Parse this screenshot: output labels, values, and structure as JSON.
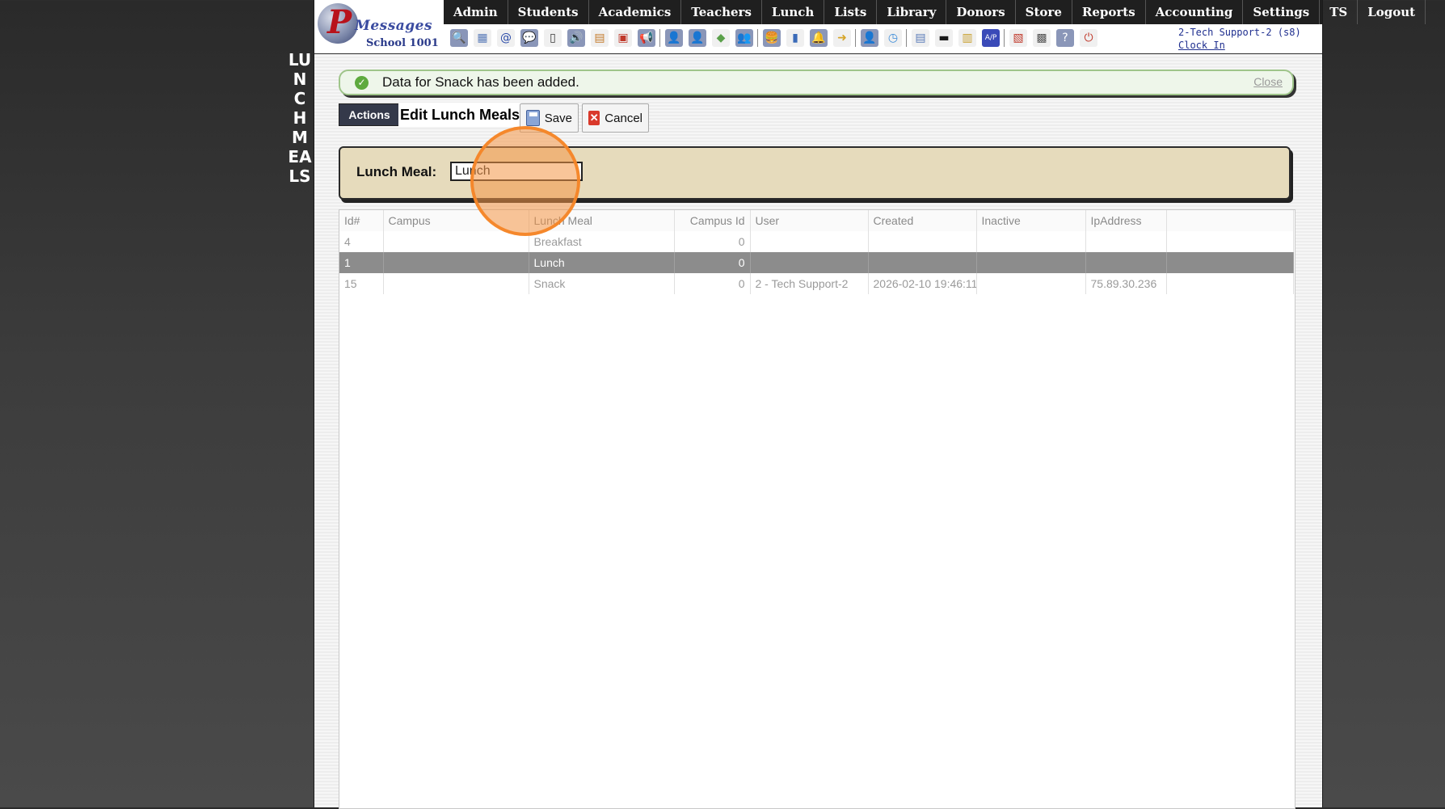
{
  "side_title": "LUNCH MEALS",
  "logo": {
    "brand": "Messages",
    "brand_letter": "P",
    "school": "School 1001"
  },
  "menu": [
    "Admin",
    "Students",
    "Academics",
    "Teachers",
    "Lunch",
    "Lists",
    "Library",
    "Donors",
    "Store",
    "Reports",
    "Accounting",
    "Settings",
    "TS",
    "Logout"
  ],
  "toolbar_icons": [
    {
      "name": "search-icon",
      "glyph": "🔍",
      "color": "#ffffff"
    },
    {
      "name": "calendar-grid-icon",
      "glyph": "▦",
      "color": "#5a7bb8"
    },
    {
      "name": "email-at-icon",
      "glyph": "@",
      "color": "#2a4aa8"
    },
    {
      "name": "chat-icon",
      "glyph": "💬",
      "color": "#ffffff"
    },
    {
      "name": "mobile-phone-icon",
      "glyph": "▯",
      "color": "#333333"
    },
    {
      "name": "speaker-icon",
      "glyph": "🔊",
      "color": "#ffffff"
    },
    {
      "name": "form-icon",
      "glyph": "▤",
      "color": "#c47a2a"
    },
    {
      "name": "calendar-icon",
      "glyph": "▣",
      "color": "#c0392b"
    },
    {
      "name": "megaphone-icon",
      "glyph": "📢",
      "color": "#ffffff"
    },
    {
      "name": "sep"
    },
    {
      "name": "student-icon",
      "glyph": "👤",
      "color": "#ffffff"
    },
    {
      "name": "teacher-icon",
      "glyph": "👤",
      "color": "#ffffff"
    },
    {
      "name": "money-icon",
      "glyph": "◆",
      "color": "#5aa04a"
    },
    {
      "name": "group-icon",
      "glyph": "👥",
      "color": "#ffffff"
    },
    {
      "name": "sep"
    },
    {
      "name": "lunch-burger-icon",
      "glyph": "🍔",
      "color": "#ffffff"
    },
    {
      "name": "book-icon",
      "glyph": "▮",
      "color": "#3a6ab8"
    },
    {
      "name": "bell-icon",
      "glyph": "🔔",
      "color": "#ffffff"
    },
    {
      "name": "store-arrow-icon",
      "glyph": "➜",
      "color": "#d6a52a"
    },
    {
      "name": "sep"
    },
    {
      "name": "person-tie-icon",
      "glyph": "👤",
      "color": "#ffffff"
    },
    {
      "name": "clock-icon",
      "glyph": "◷",
      "color": "#3a8ad8"
    },
    {
      "name": "sep"
    },
    {
      "name": "report-page-icon",
      "glyph": "▤",
      "color": "#5a7bb8"
    },
    {
      "name": "card-icon",
      "glyph": "▬",
      "color": "#1a1a1a"
    },
    {
      "name": "printer-icon",
      "glyph": "▥",
      "color": "#c8a030"
    },
    {
      "name": "ap-icon",
      "glyph": "A/P",
      "color": "#ffffff"
    },
    {
      "name": "sep"
    },
    {
      "name": "pdf-icon",
      "glyph": "▧",
      "color": "#c0392b"
    },
    {
      "name": "cash-register-icon",
      "glyph": "▩",
      "color": "#555555"
    },
    {
      "name": "help-icon",
      "glyph": "?",
      "color": "#ffffff"
    },
    {
      "name": "power-icon",
      "glyph": "⏻",
      "color": "#c0392b"
    }
  ],
  "user": {
    "name": "2-Tech Support-2 (s8)",
    "clock_in": "Clock In"
  },
  "notice": {
    "message": "Data for Snack has been added.",
    "close": "Close"
  },
  "actions": {
    "tab_label": "Actions",
    "title": "Edit Lunch Meals",
    "save": "Save",
    "cancel": "Cancel"
  },
  "form": {
    "label": "Lunch Meal:",
    "value": "Lunch"
  },
  "table": {
    "headers": [
      "Id#",
      "Campus",
      "Lunch Meal",
      "Campus Id",
      "User",
      "Created",
      "Inactive",
      "IpAddress"
    ],
    "rows": [
      {
        "id": "4",
        "campus": "",
        "meal": "Breakfast",
        "campus_id": "0",
        "user": "",
        "created": "",
        "inactive": "",
        "ip": "",
        "selected": false
      },
      {
        "id": "1",
        "campus": "",
        "meal": "Lunch",
        "campus_id": "0",
        "user": "",
        "created": "",
        "inactive": "",
        "ip": "",
        "selected": true
      },
      {
        "id": "15",
        "campus": "",
        "meal": "Snack",
        "campus_id": "0",
        "user": "2 - Tech Support-2",
        "created": "2026-02-10 19:46:11",
        "inactive": "",
        "ip": "75.89.30.236",
        "selected": false
      }
    ]
  },
  "colors": {
    "accent_marker": "#f48526",
    "selected_row": "#8c8c8c",
    "menu_bg": "#1f1f1f",
    "form_panel": "#e6dbbc"
  }
}
